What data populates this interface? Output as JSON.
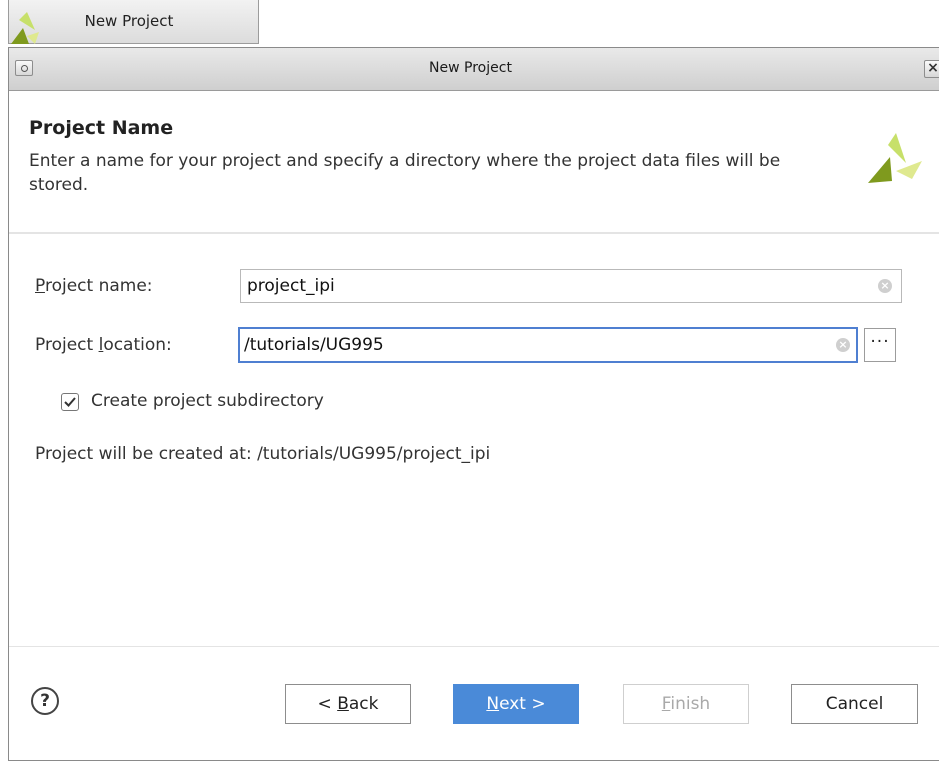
{
  "taskbar": {
    "tab_label": "New Project"
  },
  "dialog": {
    "title": "New Project",
    "close_glyph": "×"
  },
  "header": {
    "heading": "Project Name",
    "description": "Enter a name for your project and specify a directory where the project data files will be stored."
  },
  "form": {
    "project_name": {
      "label_mnemonic": "P",
      "label_rest": "roject name:",
      "value": "project_ipi"
    },
    "project_location": {
      "label_before": "Project ",
      "label_mnemonic": "l",
      "label_after": "ocation:",
      "value": "/tutorials/UG995"
    },
    "browse_label": "···",
    "create_subdirectory": {
      "label": "Create project subdirectory",
      "checked": true
    },
    "created_at_text": "Project will be created at: /tutorials/UG995/project_ipi"
  },
  "footer": {
    "help_glyph": "?",
    "back": {
      "prefix": "< ",
      "mnemonic": "B",
      "rest": "ack"
    },
    "next": {
      "mnemonic": "N",
      "rest": "ext >"
    },
    "finish": {
      "mnemonic": "F",
      "rest": "inish",
      "enabled": false
    },
    "cancel": "Cancel"
  },
  "icons": {
    "logo": "xilinx-logo-icon",
    "clear": "clear-icon",
    "help": "help-icon",
    "checkmark": "checkmark-icon"
  },
  "colors": {
    "accent": "#4a8ad8",
    "focus_border": "#4f7fd1",
    "logo_dark": "#7f9a1e",
    "logo_light": "#c7e06a"
  }
}
